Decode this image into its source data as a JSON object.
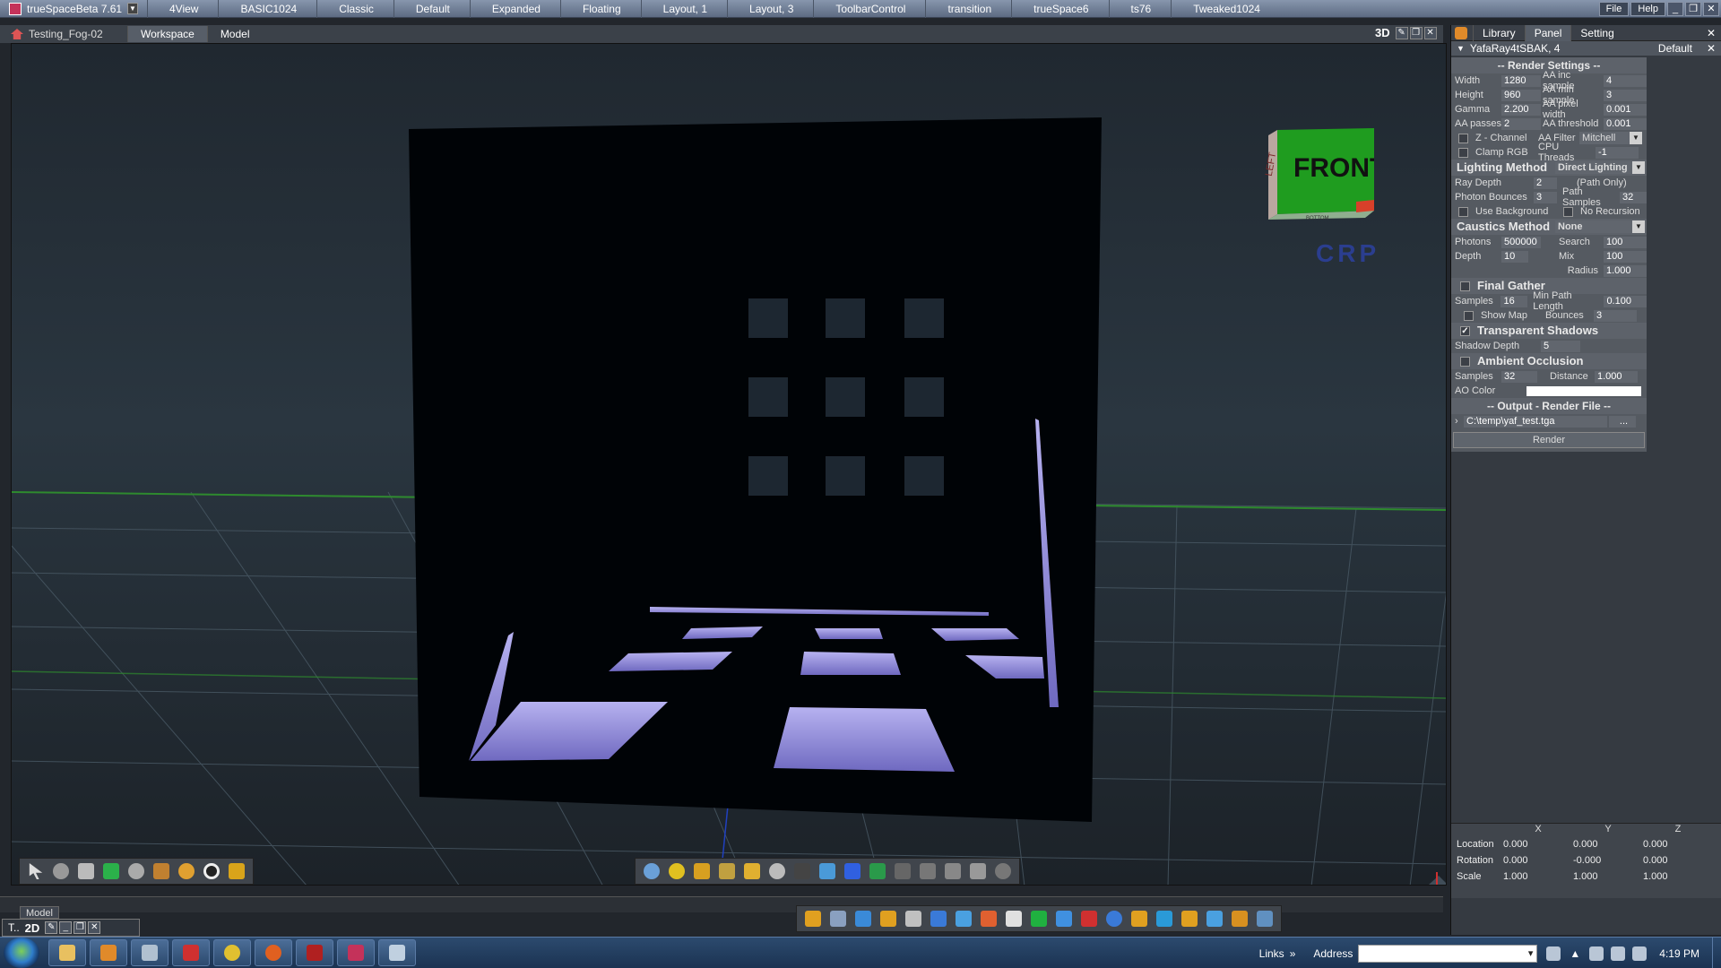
{
  "app": {
    "title": "trueSpaceBeta 7.61",
    "menu_file": "File",
    "menu_help": "Help"
  },
  "layouts": [
    "4View",
    "BASIC1024",
    "Classic",
    "Default",
    "Expanded",
    "Floating",
    "Layout, 1",
    "Layout, 3",
    "ToolbarControl",
    "transition",
    "trueSpace6",
    "ts76",
    "Tweaked1024"
  ],
  "document": {
    "title": "Testing_Fog-02",
    "tabs": [
      "Workspace",
      "Model"
    ],
    "view_mode": "3D"
  },
  "viewport": {
    "navcube_front": "FRONT",
    "navcube_left": "LEFT",
    "navcube_bottom": "BOTTOM",
    "crp_label": "CRP"
  },
  "statusbar": {
    "model_label": "Model"
  },
  "mini_window": {
    "title": "T..",
    "mode": "2D"
  },
  "panel": {
    "tabs": [
      "Library",
      "Panel",
      "Setting"
    ],
    "header_title": "YafaRay4tSBAK, 4",
    "header_right": "Default",
    "render_settings_title": "-- Render Settings --",
    "width_label": "Width",
    "width": "1280",
    "height_label": "Height",
    "height": "960",
    "gamma_label": "Gamma",
    "gamma": "2.200",
    "aa_passes_label": "AA passes",
    "aa_passes": "2",
    "aa_inc_label": "AA inc sample",
    "aa_inc": "4",
    "aa_min_label": "AA min sample",
    "aa_min": "3",
    "aa_pixel_label": "AA pixel width",
    "aa_pixel": "0.001",
    "aa_threshold_label": "AA threshold",
    "aa_threshold": "0.001",
    "zchannel_label": "Z - Channel",
    "aa_filter_label": "AA Filter",
    "aa_filter": "Mitchell",
    "clamp_label": "Clamp RGB",
    "cpu_label": "CPU Threads",
    "cpu": "-1",
    "lighting_label": "Lighting Method",
    "lighting": "Direct Lighting",
    "ray_depth_label": "Ray Depth",
    "ray_depth": "2",
    "path_only": "(Path Only)",
    "photon_bounces_label": "Photon Bounces",
    "photon_bounces": "3",
    "path_samples_label": "Path Samples",
    "path_samples": "32",
    "use_background_label": "Use Background",
    "no_recursion_label": "No Recursion",
    "caustics_label": "Caustics Method",
    "caustics": "None",
    "photons_label": "Photons",
    "photons": "500000",
    "search_label": "Search",
    "search": "100",
    "depth_label": "Depth",
    "depth": "10",
    "mix_label": "Mix",
    "mix": "100",
    "radius_label": "Radius",
    "radius": "1.000",
    "final_gather_label": "Final Gather",
    "fg_samples_label": "Samples",
    "fg_samples": "16",
    "min_path_label": "Min Path Length",
    "min_path": "0.100",
    "show_map_label": "Show Map",
    "bounces_label": "Bounces",
    "bounces": "3",
    "transparent_shadows_label": "Transparent Shadows",
    "shadow_depth_label": "Shadow Depth",
    "shadow_depth": "5",
    "ao_label": "Ambient Occlusion",
    "ao_samples_label": "Samples",
    "ao_samples": "32",
    "distance_label": "Distance",
    "distance": "1.000",
    "ao_color_label": "AO Color",
    "ao_color": "#ffffff",
    "output_title": "-- Output - Render File --",
    "output_path": "C:\\temp\\yaf_test.tga",
    "browse": "...",
    "render_button": "Render"
  },
  "transform": {
    "headers": [
      "X",
      "Y",
      "Z"
    ],
    "rows": [
      {
        "label": "Location",
        "x": "0.000",
        "y": "0.000",
        "z": "0.000"
      },
      {
        "label": "Rotation",
        "x": "0.000",
        "y": "-0.000",
        "z": "0.000"
      },
      {
        "label": "Scale",
        "x": "1.000",
        "y": "1.000",
        "z": "1.000"
      }
    ]
  },
  "taskbar": {
    "links_label": "Links",
    "address_label": "Address",
    "time": "4:19 PM"
  },
  "colors": {
    "accent": "#e08a2a",
    "crp": "#2b3e8f",
    "floor_light": "#8c86d8"
  }
}
